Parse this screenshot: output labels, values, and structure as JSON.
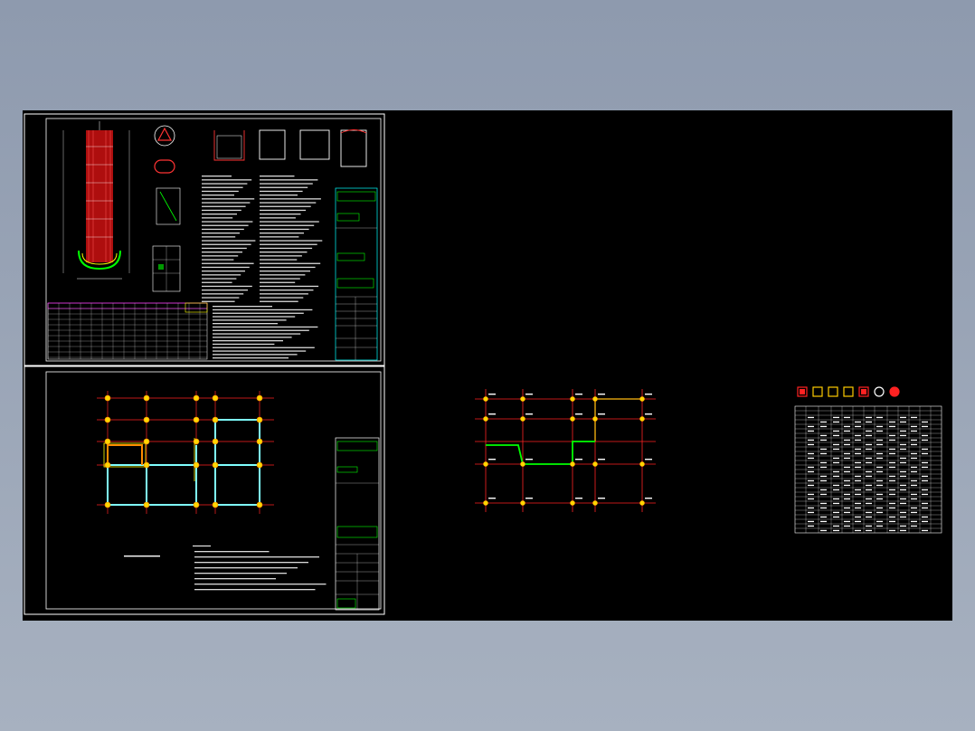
{
  "colors": {
    "background_top": "#8e9aae",
    "background_bottom": "#a7b1c0",
    "canvas": "#000000",
    "sheet_border": "#ffffff",
    "axis_line": "#ff0000",
    "column": "#ffff00",
    "wall": "#ffff00",
    "beam_cyan": "#7fffff",
    "highlight_orange": "#ff8c00",
    "highlight_green": "#00ff00",
    "title_block_green": "#00ff00",
    "table_red": "#ff0000",
    "table_magenta": "#ff00ff",
    "table_white": "#ffffff"
  },
  "sheets": {
    "top_left": {
      "name": "pile-detail-sheet"
    },
    "bottom_left": {
      "name": "foundation-plan-sheet"
    },
    "middle_right": {
      "name": "axis-grid-plan"
    },
    "far_right": {
      "name": "pile-schedule-table"
    }
  },
  "legend_symbols": [
    "square-red",
    "square-yellow",
    "square-yellow",
    "square-yellow",
    "square-red",
    "circle-white",
    "circle-red"
  ]
}
